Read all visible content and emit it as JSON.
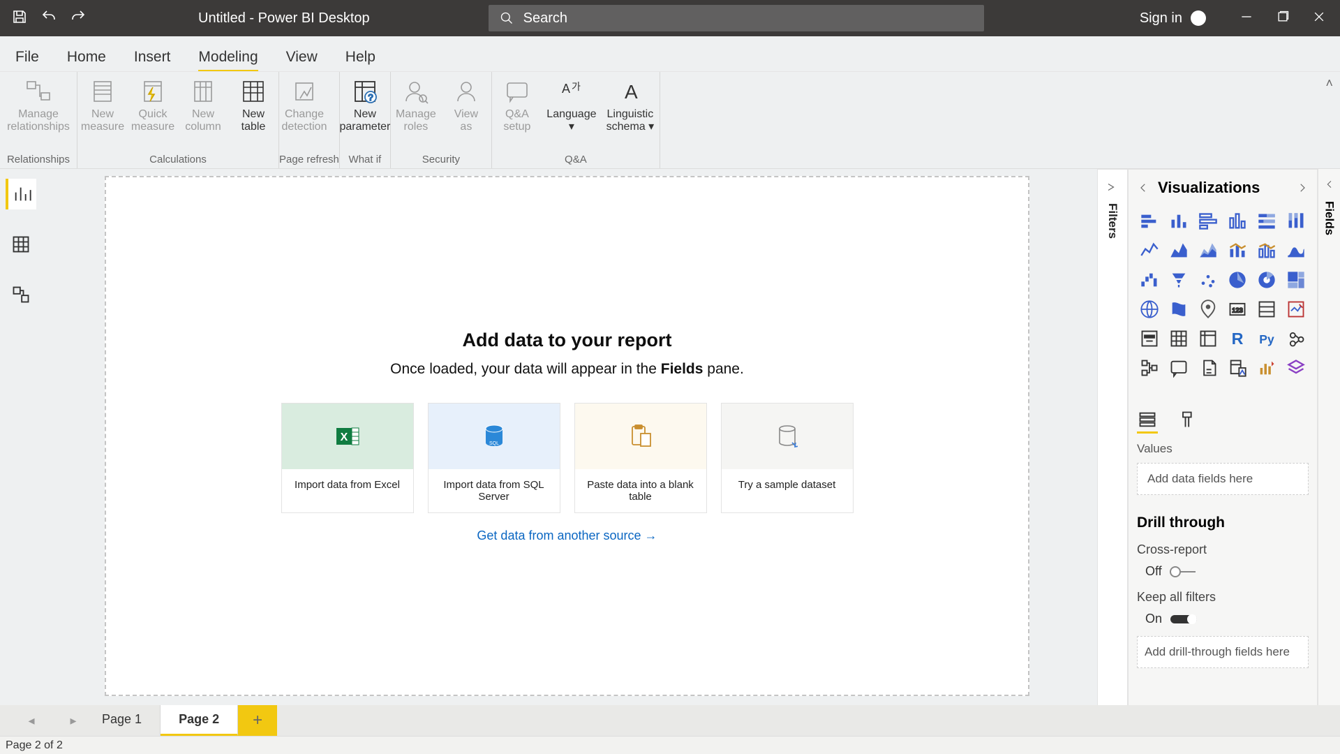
{
  "titlebar": {
    "title": "Untitled - Power BI Desktop",
    "search_placeholder": "Search",
    "signin": "Sign in"
  },
  "menu": {
    "tabs": [
      "File",
      "Home",
      "Insert",
      "Modeling",
      "View",
      "Help"
    ],
    "active_index": 3
  },
  "ribbon": {
    "groups": [
      {
        "label": "Relationships",
        "buttons": [
          {
            "name": "manage-relationships",
            "lines": [
              "Manage",
              "relationships"
            ],
            "disabled": true
          }
        ]
      },
      {
        "label": "Calculations",
        "buttons": [
          {
            "name": "new-measure",
            "lines": [
              "New",
              "measure"
            ],
            "disabled": true
          },
          {
            "name": "quick-measure",
            "lines": [
              "Quick",
              "measure"
            ],
            "disabled": true
          },
          {
            "name": "new-column",
            "lines": [
              "New",
              "column"
            ],
            "disabled": true
          },
          {
            "name": "new-table",
            "lines": [
              "New",
              "table"
            ],
            "disabled": false
          }
        ]
      },
      {
        "label": "Page refresh",
        "buttons": [
          {
            "name": "change-detection",
            "lines": [
              "Change",
              "detection"
            ],
            "disabled": true
          }
        ]
      },
      {
        "label": "What if",
        "buttons": [
          {
            "name": "new-parameter",
            "lines": [
              "New",
              "parameter"
            ],
            "disabled": false
          }
        ]
      },
      {
        "label": "Security",
        "buttons": [
          {
            "name": "manage-roles",
            "lines": [
              "Manage",
              "roles"
            ],
            "disabled": true
          },
          {
            "name": "view-as",
            "lines": [
              "View",
              "as"
            ],
            "disabled": true
          }
        ]
      },
      {
        "label": "Q&A",
        "buttons": [
          {
            "name": "qa-setup",
            "lines": [
              "Q&A",
              "setup"
            ],
            "disabled": true
          },
          {
            "name": "language",
            "lines": [
              "Language",
              "▾"
            ],
            "disabled": false
          },
          {
            "name": "linguistic-schema",
            "lines": [
              "Linguistic",
              "schema ▾"
            ],
            "disabled": false
          }
        ]
      }
    ]
  },
  "left_views": [
    "report",
    "data",
    "model"
  ],
  "canvas": {
    "heading": "Add data to your report",
    "subtext_pre": "Once loaded, your data will appear in the ",
    "subtext_bold": "Fields",
    "subtext_post": " pane.",
    "cards": [
      {
        "key": "excel",
        "label": "Import data from Excel"
      },
      {
        "key": "sql",
        "label": "Import data from SQL Server"
      },
      {
        "key": "paste",
        "label": "Paste data into a blank table"
      },
      {
        "key": "sample",
        "label": "Try a sample dataset"
      }
    ],
    "another_source": "Get data from another source →"
  },
  "filters_label": "Filters",
  "viz_pane": {
    "title": "Visualizations",
    "values_label": "Values",
    "values_placeholder": "Add data fields here",
    "drill_title": "Drill through",
    "cross_report_label": "Cross-report",
    "cross_report_value": "Off",
    "keep_filters_label": "Keep all filters",
    "keep_filters_value": "On",
    "drill_placeholder": "Add drill-through fields here",
    "icon_names": [
      "stacked-bar",
      "stacked-column",
      "clustered-bar",
      "clustered-column",
      "100-stacked-bar",
      "100-stacked-column",
      "line",
      "area",
      "stacked-area",
      "line-stacked-col",
      "line-clustered-col",
      "ribbon",
      "waterfall",
      "funnel",
      "scatter",
      "pie",
      "donut",
      "treemap",
      "map",
      "filled-map",
      "arcgis",
      "card",
      "multi-row-card",
      "kpi",
      "slicer",
      "table",
      "matrix",
      "r-visual",
      "python-visual",
      "key-influencers",
      "decomp-tree",
      "qa-visual",
      "paginated",
      "smart-narrative",
      "anomaly",
      "app-store"
    ]
  },
  "fields_label": "Fields",
  "page_tabs": {
    "tabs": [
      "Page 1",
      "Page 2"
    ],
    "active_index": 1
  },
  "statusbar": "Page 2 of 2"
}
